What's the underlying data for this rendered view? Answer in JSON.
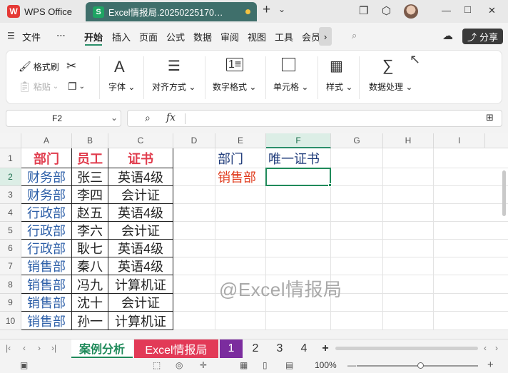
{
  "titlebar": {
    "app_name": "WPS Office",
    "doc_title": "Excel情报局.20250225170…",
    "new_tab": "+",
    "new_tab_menu": "⌄",
    "min": "—",
    "max": "□",
    "close": "✕"
  },
  "menubar": {
    "file": "文件",
    "more": "⋯",
    "items": [
      "开始",
      "插入",
      "页面",
      "公式",
      "数据",
      "审阅",
      "视图",
      "工具",
      "会员"
    ],
    "share": "分享"
  },
  "ribbon": {
    "format_painter": "格式刷",
    "paste": "粘贴",
    "font": "字体",
    "align": "对齐方式",
    "number_format": "数字格式",
    "cell": "单元格",
    "style": "样式",
    "data_process": "数据处理"
  },
  "formula": {
    "name_box": "F2",
    "fx": "fx",
    "content": ""
  },
  "grid": {
    "columns": [
      "A",
      "B",
      "C",
      "D",
      "E",
      "F",
      "G",
      "H",
      "I"
    ],
    "rows": [
      "1",
      "2",
      "3",
      "4",
      "5",
      "6",
      "7",
      "8",
      "9",
      "10"
    ],
    "table_header": [
      "部门",
      "员工",
      "证书"
    ],
    "table_rows": [
      [
        "财务部",
        "张三",
        "英语4级"
      ],
      [
        "财务部",
        "李四",
        "会计证"
      ],
      [
        "行政部",
        "赵五",
        "英语4级"
      ],
      [
        "行政部",
        "李六",
        "会计证"
      ],
      [
        "行政部",
        "耿七",
        "英语4级"
      ],
      [
        "销售部",
        "秦八",
        "英语4级"
      ],
      [
        "销售部",
        "冯九",
        "计算机证"
      ],
      [
        "销售部",
        "沈十",
        "会计证"
      ],
      [
        "销售部",
        "孙一",
        "计算机证"
      ]
    ],
    "e1": "部门",
    "f1": "唯一证书",
    "e2": "销售部",
    "watermark": "@Excel情报局"
  },
  "sheets": {
    "tabs": [
      "案例分析",
      "Excel情报局",
      "1",
      "2",
      "3",
      "4"
    ],
    "add": "+"
  },
  "status": {
    "zoom": "100%"
  },
  "colors": {
    "accent": "#1f8a5a",
    "header_red": "#e03c4d",
    "dept_blue": "#2d5fa8",
    "tab_red": "#e23a57",
    "tab_purple": "#7b2c9e"
  }
}
